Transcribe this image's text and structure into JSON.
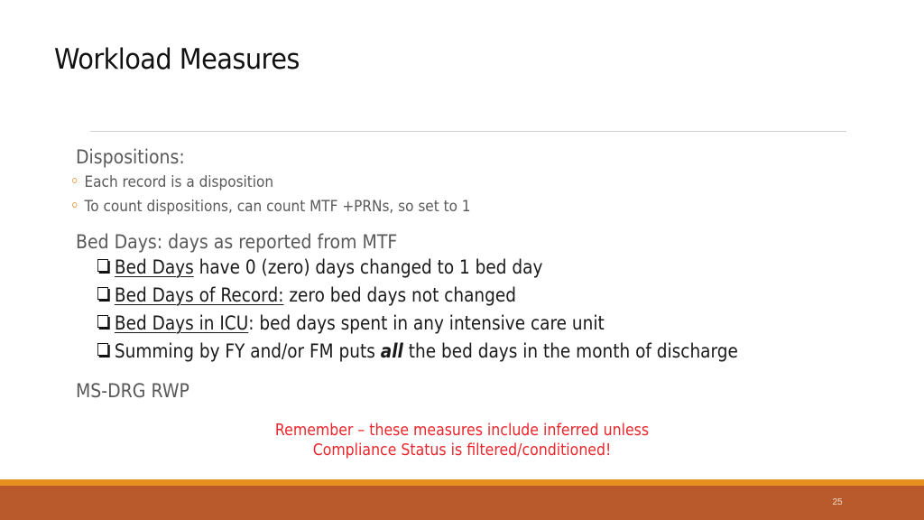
{
  "slide": {
    "title": "Workload Measures",
    "page_number": "25"
  },
  "sections": {
    "dispositions": {
      "heading": "Dispositions:",
      "items": [
        "Each record is a disposition",
        "To count dispositions, can count MTF +PRNs, so set to 1"
      ]
    },
    "bed_days": {
      "heading": "Bed Days: days as reported from MTF",
      "items": [
        {
          "term": "Bed Days",
          "rest": " have 0 (zero) days changed to 1 bed day"
        },
        {
          "term": "Bed Days of Record:",
          "rest": " zero bed days not changed"
        },
        {
          "term": "Bed Days in ICU",
          "rest": ": bed days spent in any intensive care unit"
        },
        {
          "pre": "Summing by FY and/or FM puts ",
          "emph": "all",
          "post": " the bed days in the month of discharge"
        }
      ]
    },
    "ms_drg": {
      "heading": "MS-DRG RWP"
    }
  },
  "note": {
    "line1": "Remember – these measures include inferred unless",
    "line2": "Compliance Status is filtered/conditioned!",
    "color": "#e8262b"
  },
  "theme": {
    "footer_stripe": "#e5901f",
    "footer_band": "#b95a2c",
    "bullet_color": "#e3a04a"
  }
}
